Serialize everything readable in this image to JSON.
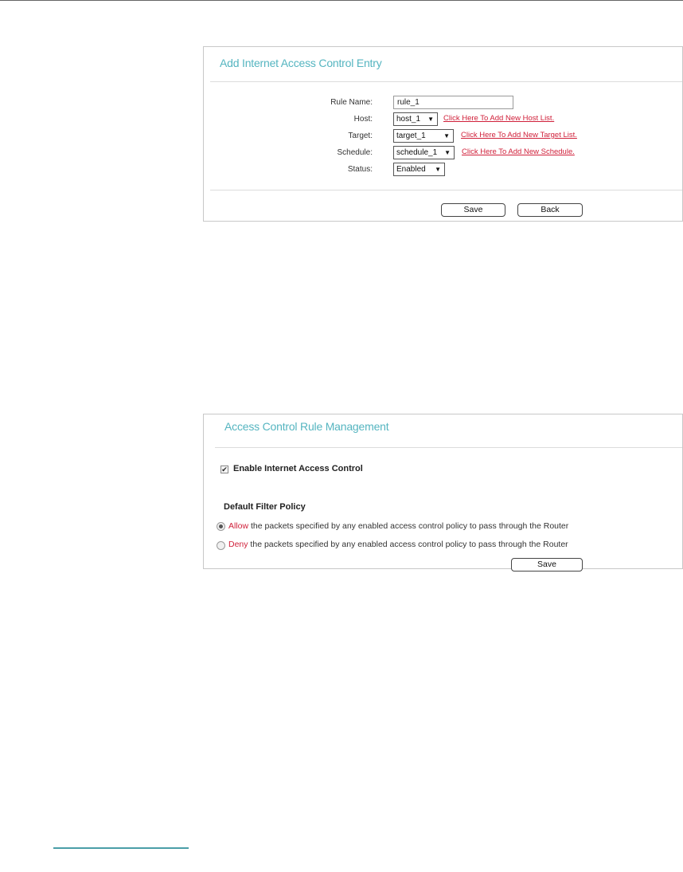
{
  "add_entry": {
    "title": "Add Internet Access Control Entry",
    "rule_name_label": "Rule Name:",
    "rule_name_value": "rule_1",
    "host_label": "Host:",
    "host_value": "host_1",
    "host_link": "Click Here To Add New Host List.",
    "target_label": "Target:",
    "target_value": "target_1",
    "target_link": "Click Here To Add New Target List.",
    "schedule_label": "Schedule:",
    "schedule_value": "schedule_1",
    "schedule_link": "Click Here To Add New Schedule.",
    "status_label": "Status:",
    "status_value": "Enabled",
    "save_label": "Save",
    "back_label": "Back"
  },
  "rule_management": {
    "title": "Access Control Rule Management",
    "enable_label": "Enable Internet Access Control",
    "enable_checked": true,
    "policy_heading": "Default Filter Policy",
    "allow_keyword": "Allow",
    "allow_text": " the packets specified by any enabled access control policy to pass through the Router",
    "deny_keyword": "Deny",
    "deny_text": " the packets specified by any enabled access control policy to pass through the Router",
    "selected_policy": "Allow",
    "save_label": "Save"
  },
  "icons": {
    "dropdown": "triangle-down-icon",
    "checkbox": "checkmark-icon"
  },
  "colors": {
    "title": "#55b5c0",
    "link": "#d0203a",
    "border": "#c8c8c8"
  }
}
